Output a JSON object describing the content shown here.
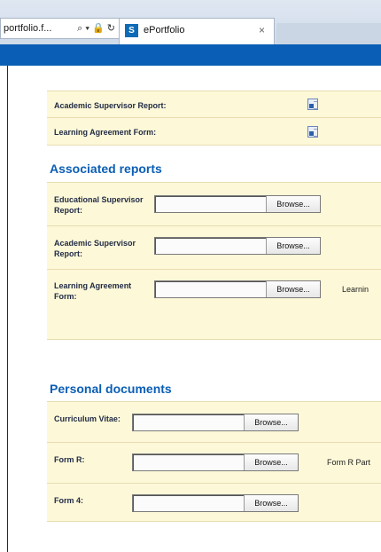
{
  "browser": {
    "address_text": "portfolio.f...",
    "address_icons": "⌕ ▾ 🔒 ↻",
    "tab_icon_text": "S",
    "tab_title": "ePortfolio",
    "tab_close": "×"
  },
  "top_rows": [
    {
      "label": "Academic Supervisor Report:"
    },
    {
      "label": "Learning Agreement Form:"
    }
  ],
  "associated_reports": {
    "title": "Associated reports",
    "rows": [
      {
        "label": "Educational Supervisor Report:",
        "button": "Browse..."
      },
      {
        "label": "Academic Supervisor Report:",
        "button": "Browse..."
      },
      {
        "label": "Learning Agreement Form:",
        "button": "Browse...",
        "side_text": "Learnin"
      }
    ]
  },
  "personal_documents": {
    "title": "Personal documents",
    "rows": [
      {
        "label": "Curriculum Vitae:",
        "button": "Browse..."
      },
      {
        "label": "Form R:",
        "button": "Browse...",
        "side_text": "Form R Part"
      },
      {
        "label": "Form 4:",
        "button": "Browse..."
      }
    ]
  }
}
